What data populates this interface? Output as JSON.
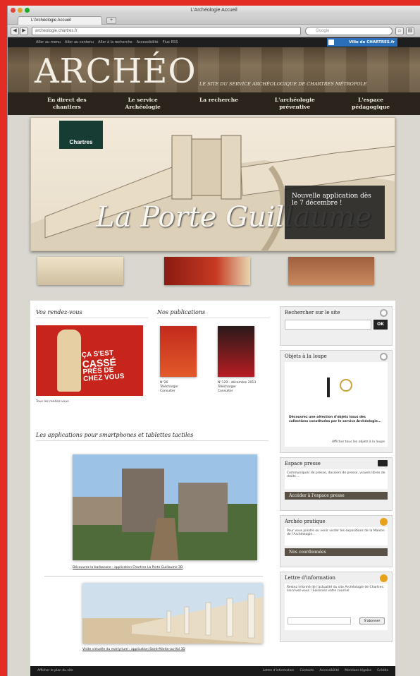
{
  "browser": {
    "window_title": "L'Archéologie Accueil",
    "tab_label": "L'Archéologie Accueil",
    "url": "archeologie.chartres.fr",
    "search_placeholder": "Google"
  },
  "topbar": {
    "links": [
      "Aller au menu",
      "Aller au contenu",
      "Aller à la recherche",
      "Accessibilité",
      "Flux RSS"
    ],
    "ville_link": "Ville de CHARTRES.fr"
  },
  "header": {
    "logo": "ARCHÉO",
    "tagline": "LE SITE DU SERVICE ARCHÉOLOGIQUE DE CHARTRES MÉTROPOLE"
  },
  "nav": {
    "items": [
      "En direct des chantiers",
      "Le service Archéologie",
      "La recherche",
      "L'archéologie préventive",
      "L'espace pédagogique"
    ]
  },
  "hero": {
    "brand": "Chartres",
    "title": "La Porte Guillaume",
    "box_text": "Nouvelle application dès le 7 décembre !"
  },
  "rendezvous": {
    "heading": "Vos rendez-vous",
    "poster_text": [
      "ÇA S'EST",
      "CASSÉ",
      "PRÈS DE",
      "CHEZ VOUS"
    ],
    "link": "Tous les rendez-vous"
  },
  "publications": {
    "heading": "Nos publications",
    "items": [
      {
        "title": "N°26",
        "links": [
          "Télécharger",
          "Consulter"
        ]
      },
      {
        "title": "N°129 - décembre 2013",
        "links": [
          "Télécharger",
          "Consulter"
        ]
      }
    ]
  },
  "apps": {
    "heading": "Les applications pour smartphones et tablettes tactiles",
    "items": [
      {
        "caption": "Découvrez la barbacane : application Chartres La Porte Guillaume 3D"
      },
      {
        "caption": "Visite virtuelle du martyrium : application Saint-Martin-au-Val 3D"
      }
    ]
  },
  "sidebar": {
    "search_title": "Rechercher sur le site",
    "search_button": "OK",
    "loupe_title": "Objets à la loupe",
    "loupe_text": "Découvrez une sélection d'objets issus des collections constituées par le service Archéologie...",
    "loupe_link": "Afficher tous les objets à la loupe",
    "presse_title": "Espace presse",
    "presse_text": "Communiqués de presse, dossiers de presse, visuels libres de droits ...",
    "presse_button": "Accéder à l'espace presse",
    "pratique_title": "Archéo pratique",
    "pratique_text": "Pour vous joindre ou venir visiter les expositions de la Maison de l'Archéologie...",
    "pratique_button": "Nos coordonnées",
    "lettre_title": "Lettre d'information",
    "lettre_text": "Restez informé de l'actualité du site Archéologie de Chartres. Inscrivez-vous ! Saisissez votre courriel",
    "lettre_button": "S'abonner"
  },
  "footer": {
    "left": "Afficher le plan du site",
    "links": [
      "Lettre d'information",
      "Contacts",
      "Accessibilité",
      "Mentions légales",
      "Crédits"
    ]
  }
}
